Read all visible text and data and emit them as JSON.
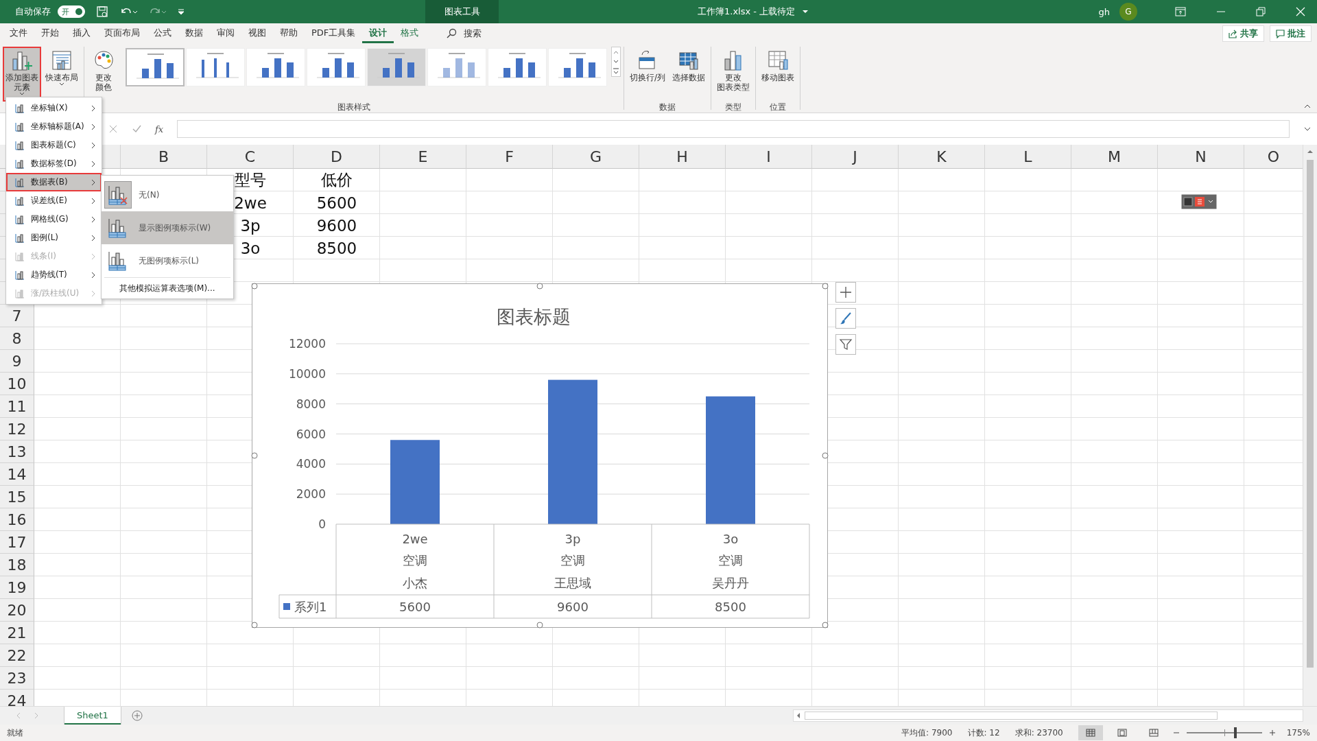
{
  "title_bar": {
    "autosave_label": "自动保存",
    "autosave_toggle": {
      "label": "开",
      "on": true
    },
    "context_tab": "图表工具",
    "document_title": "工作簿1.xlsx  -  上载待定",
    "user": "gh",
    "avatar": "G"
  },
  "menu_tabs": [
    {
      "label": "文件",
      "selected": false,
      "contextual": false
    },
    {
      "label": "开始",
      "selected": false,
      "contextual": false
    },
    {
      "label": "插入",
      "selected": false,
      "contextual": false
    },
    {
      "label": "页面布局",
      "selected": false,
      "contextual": false
    },
    {
      "label": "公式",
      "selected": false,
      "contextual": false
    },
    {
      "label": "数据",
      "selected": false,
      "contextual": false
    },
    {
      "label": "审阅",
      "selected": false,
      "contextual": false
    },
    {
      "label": "视图",
      "selected": false,
      "contextual": false
    },
    {
      "label": "帮助",
      "selected": false,
      "contextual": false
    },
    {
      "label": "PDF工具集",
      "selected": false,
      "contextual": false
    },
    {
      "label": "设计",
      "selected": true,
      "contextual": true
    },
    {
      "label": "格式",
      "selected": false,
      "contextual": true
    }
  ],
  "search": {
    "label": "搜索"
  },
  "share_button": "共享",
  "comments_button": "批注",
  "ribbon": {
    "layout_buttons": [
      {
        "label_lines": [
          "添加图表",
          "元素"
        ],
        "selected": true
      },
      {
        "label_lines": [
          "快速布局"
        ],
        "selected": false
      }
    ],
    "color_button": {
      "label_lines": [
        "更改",
        "颜色"
      ]
    },
    "chart_styles": [
      {
        "selected": true
      },
      {
        "selected": false
      },
      {
        "selected": false
      },
      {
        "selected": false
      },
      {
        "selected": false
      },
      {
        "selected": false
      },
      {
        "selected": false
      },
      {
        "selected": false
      }
    ],
    "style_group_label": "图表样式",
    "groups": [
      {
        "label": "数据",
        "buttons": [
          {
            "label_lines": [
              "切换行/列"
            ]
          },
          {
            "label_lines": [
              "选择数据"
            ]
          }
        ]
      },
      {
        "label": "类型",
        "buttons": [
          {
            "label_lines": [
              "更改",
              "图表类型"
            ]
          }
        ]
      },
      {
        "label": "位置",
        "buttons": [
          {
            "label_lines": [
              "移动图表"
            ]
          }
        ]
      }
    ]
  },
  "formula_bar": {
    "function_label": "fx"
  },
  "element_menu": {
    "items": [
      {
        "label": "坐标轴(X)",
        "disabled": false,
        "selected": false
      },
      {
        "label": "坐标轴标题(A)",
        "disabled": false,
        "selected": false
      },
      {
        "label": "图表标题(C)",
        "disabled": false,
        "selected": false
      },
      {
        "label": "数据标签(D)",
        "disabled": false,
        "selected": false
      },
      {
        "label": "数据表(B)",
        "disabled": false,
        "selected": true
      },
      {
        "label": "误差线(E)",
        "disabled": false,
        "selected": false
      },
      {
        "label": "网格线(G)",
        "disabled": false,
        "selected": false
      },
      {
        "label": "图例(L)",
        "disabled": false,
        "selected": false
      },
      {
        "label": "线条(I)",
        "disabled": true,
        "selected": false
      },
      {
        "label": "趋势线(T)",
        "disabled": false,
        "selected": false
      },
      {
        "label": "涨/跌柱线(U)",
        "disabled": true,
        "selected": false
      }
    ]
  },
  "data_table_submenu": {
    "items": [
      {
        "label": "无(N)",
        "current": true,
        "selected": false
      },
      {
        "label": "显示图例项标示(W)",
        "current": false,
        "selected": true
      },
      {
        "label": "无图例项标示(L)",
        "current": false,
        "selected": false
      }
    ],
    "more_options": "其他模拟运算表选项(M)..."
  },
  "sheet": {
    "columns": [
      "B",
      "C",
      "D",
      "E",
      "F",
      "G",
      "H",
      "I",
      "J",
      "K",
      "L",
      "M",
      "N",
      "O"
    ],
    "rows": [
      "7",
      "8",
      "9",
      "10",
      "11",
      "12",
      "13",
      "14",
      "15",
      "16",
      "17",
      "18",
      "19",
      "20",
      "21",
      "22",
      "23",
      "24"
    ],
    "column_c": [
      "型号",
      "2we",
      "3p",
      "3o"
    ],
    "column_d": [
      "低价",
      "5600",
      "9600",
      "8500"
    ]
  },
  "chart": {
    "chart_data": {
      "type": "bar",
      "title": "图表标题",
      "categories": [
        "2we",
        "3p",
        "3o"
      ],
      "series": [
        {
          "name": "系列1",
          "color": "#4472c4",
          "values": [
            5600,
            9600,
            8500
          ]
        }
      ],
      "ylim": [
        0,
        12000
      ],
      "yticks": [
        0,
        2000,
        4000,
        6000,
        8000,
        10000,
        12000
      ],
      "grid": true
    },
    "value_row": [
      "5600",
      "9600",
      "8500"
    ],
    "category_rows": [
      [
        "空调",
        "空调",
        "空调"
      ],
      [
        "小杰",
        "王思域",
        "吴丹丹"
      ]
    ]
  },
  "sheet_tabs": [
    {
      "label": "Sheet1",
      "selected": true
    }
  ],
  "status_bar": {
    "ready": "就绪",
    "average": "平均值: 7900",
    "count": "计数: 12",
    "sum": "求和: 23700",
    "views": [
      {
        "selected": true
      },
      {
        "selected": false
      },
      {
        "selected": false
      }
    ],
    "zoom": {
      "level": 0.65,
      "label": "175%"
    }
  }
}
